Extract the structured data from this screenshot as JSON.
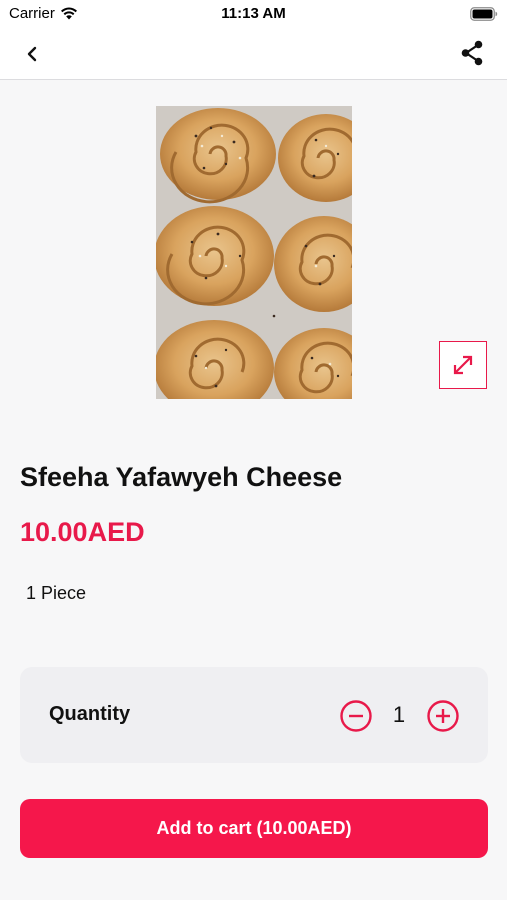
{
  "status": {
    "carrier": "Carrier",
    "time": "11:13 AM"
  },
  "nav": {
    "back_icon": "chevron-left-icon",
    "share_icon": "share-icon"
  },
  "product": {
    "title": "Sfeeha Yafawyeh Cheese",
    "price": "10.00AED",
    "unit": "1 Piece"
  },
  "quantity": {
    "label": "Quantity",
    "value": "1"
  },
  "cart_button": {
    "label": "Add to cart (10.00AED)"
  },
  "colors": {
    "accent": "#f5174b",
    "price": "#e8194a",
    "card_bg": "#efeff2"
  }
}
